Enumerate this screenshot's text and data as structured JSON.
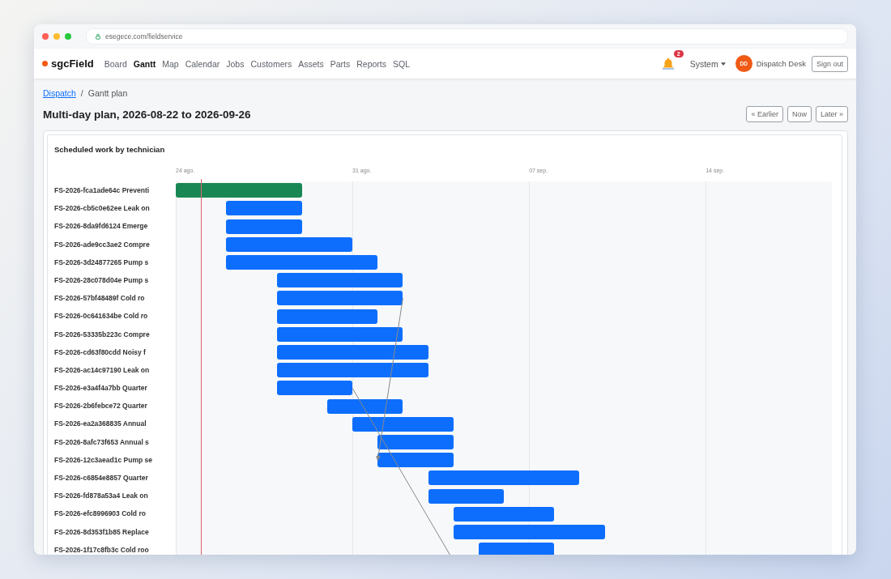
{
  "browser": {
    "url": "esegece.com/fieldservice"
  },
  "navbar": {
    "brand": "sgcField",
    "links": [
      {
        "label": "Board",
        "selected": false
      },
      {
        "label": "Gantt",
        "selected": true
      },
      {
        "label": "Map",
        "selected": false
      },
      {
        "label": "Calendar",
        "selected": false
      },
      {
        "label": "Jobs",
        "selected": false
      },
      {
        "label": "Customers",
        "selected": false
      },
      {
        "label": "Assets",
        "selected": false
      },
      {
        "label": "Parts",
        "selected": false
      },
      {
        "label": "Reports",
        "selected": false
      },
      {
        "label": "SQL",
        "selected": false
      }
    ],
    "notifications": "2",
    "menu": "System",
    "avatar": "DD",
    "user": "Dispatch Desk",
    "sign_out": "Sign out"
  },
  "breadcrumb": {
    "link": "Dispatch",
    "separator": "/",
    "current": "Gantt plan"
  },
  "title": "Multi-day plan, 2026-08-22 to 2026-09-26",
  "pager": [
    "« Earlier",
    "Now",
    "Later »"
  ],
  "gantt": {
    "title": "Scheduled work by technician",
    "ticks": [
      "24 ago.",
      "31 ago.",
      "07 sep.",
      "14 sep."
    ],
    "tasks": [
      {
        "label": "FS-2026-fca1ade64c Preventi",
        "color": "#198754"
      },
      {
        "label": "FS-2026-cb5c0e62ee Leak on",
        "color": "#0d6efd"
      },
      {
        "label": "FS-2026-8da9fd6124 Emerge",
        "color": "#0d6efd"
      },
      {
        "label": "FS-2026-ade9cc3ae2 Compre",
        "color": "#0d6efd"
      },
      {
        "label": "FS-2026-3d24877265 Pump s",
        "color": "#0d6efd"
      },
      {
        "label": "FS-2026-28c078d04e Pump s",
        "color": "#0d6efd"
      },
      {
        "label": "FS-2026-57bf48489f Cold ro",
        "color": "#0d6efd"
      },
      {
        "label": "FS-2026-0c641634be Cold ro",
        "color": "#0d6efd"
      },
      {
        "label": "FS-2026-53335b223c Compre",
        "color": "#0d6efd"
      },
      {
        "label": "FS-2026-cd63f80cdd Noisy f",
        "color": "#0d6efd"
      },
      {
        "label": "FS-2026-ac14c97190 Leak on",
        "color": "#0d6efd"
      },
      {
        "label": "FS-2026-e3a4f4a7bb Quarter",
        "color": "#0d6efd"
      },
      {
        "label": "FS-2026-2b6febce72 Quarter",
        "color": "#0d6efd"
      },
      {
        "label": "FS-2026-ea2a368835 Annual",
        "color": "#0d6efd"
      },
      {
        "label": "FS-2026-8afc73f653 Annual s",
        "color": "#0d6efd"
      },
      {
        "label": "FS-2026-12c3aead1c Pump se",
        "color": "#0d6efd"
      },
      {
        "label": "FS-2026-c6854e8857 Quarter",
        "color": "#0d6efd"
      },
      {
        "label": "FS-2026-fd878a53a4 Leak on",
        "color": "#0d6efd"
      },
      {
        "label": "FS-2026-efc8996903 Cold ro",
        "color": "#0d6efd"
      },
      {
        "label": "FS-2026-8d353f1b85 Replace",
        "color": "#0d6efd"
      },
      {
        "label": "FS-2026-1f17c8fb3c Cold roo",
        "color": "#0d6efd"
      }
    ]
  }
}
